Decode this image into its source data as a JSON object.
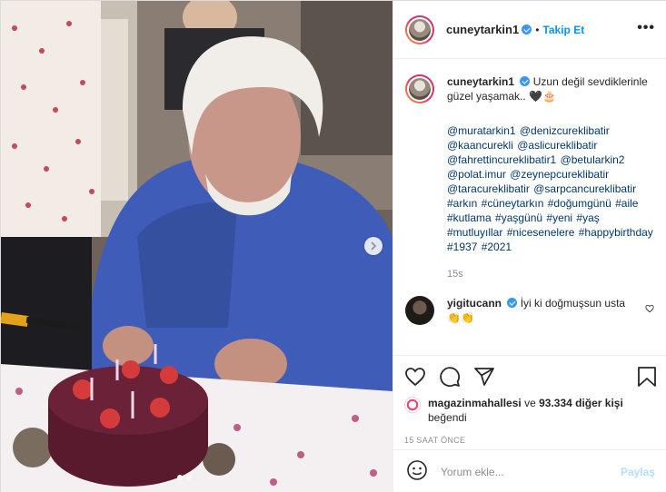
{
  "post": {
    "username": "cuneytarkin1",
    "separator": "•",
    "follow_label": "Takip Et",
    "more_label": "•••"
  },
  "caption": {
    "username": "cuneytarkin1",
    "text": "Uzun değil sevdiklerinle güzel yaşamak.. 🖤🎂",
    "tags": "@muratarkin1 @denizcureklibatir @kaancurekli @aslicureklibatir @fahrettincureklibatir1 @betularkin2 @polat.imur @zeynepcureklibatir @taracureklibatir @sarpcancureklibatir #arkın #cüneytarkın #doğumgünü #aile #kutlama #yaşgünü #yeni #yaş #mutluyıllar #nicesenelere #happybirthday #1937 #2021",
    "time": "15s"
  },
  "comment": {
    "username": "yigitucann",
    "text": "İyi ki doğmuşsun usta👏👏"
  },
  "icons": {
    "like": "heart-icon",
    "comment": "comment-icon",
    "share": "share-icon",
    "save": "bookmark-icon",
    "emoji": "emoji-icon",
    "next": "chevron-right-icon"
  },
  "likes": {
    "user": "magazinmahallesi",
    "connector": "ve",
    "count_text": "93.334 diğer kişi",
    "suffix": "beğendi"
  },
  "timestamp": "15 SAAT ÖNCE",
  "add_comment": {
    "placeholder": "Yorum ekle...",
    "post_label": "Paylaş"
  },
  "colors": {
    "accent": "#0095f6",
    "verified": "#3897f0",
    "tag": "#00376b",
    "muted": "#8e8e8e",
    "post_disabled": "#b2dffc"
  }
}
